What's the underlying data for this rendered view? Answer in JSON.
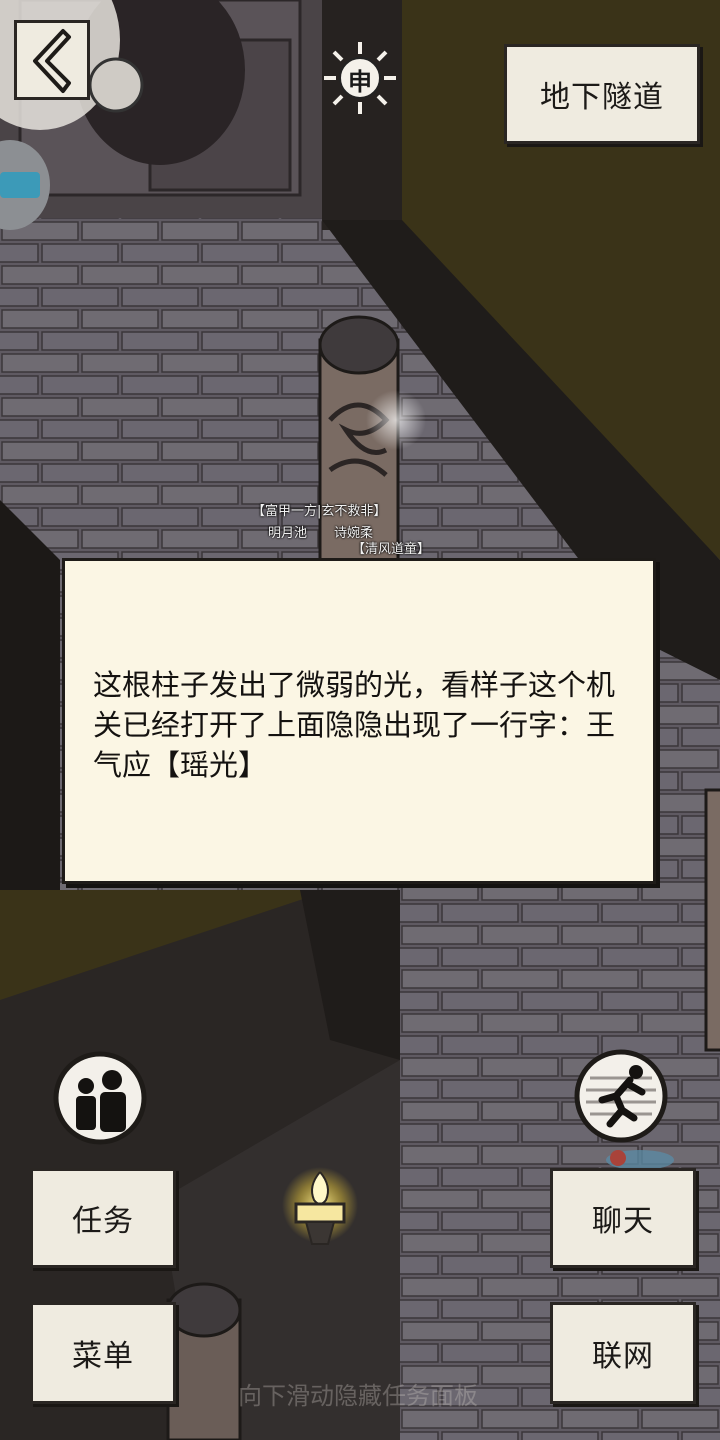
{
  "location": {
    "label": "地下隧道"
  },
  "time_badge": {
    "glyph": "申",
    "icon": "sun-icon"
  },
  "player_tags": {
    "title_top": "【富甲一方|玄不救非】",
    "name_left": "明月池",
    "name_right": "诗婉柔",
    "title_bottom": "【清风道童】"
  },
  "dialog": {
    "text": "这根柱子发出了微弱的光，看样子这个机关已经打开了上面隐隐出现了一行字：王气应【瑶光】"
  },
  "buttons": {
    "task": "任务",
    "menu": "菜单",
    "chat": "聊天",
    "online": "联网"
  },
  "icons": {
    "back": "back-arrow-icon",
    "party": "party-people-icon",
    "run": "run-icon",
    "torch": "torch-icon",
    "app_badge": "app-badge-icon"
  },
  "hint": "向下滑动隐藏任务面板",
  "colors": {
    "paper": "#efebe0",
    "dialog_bg": "#fbf6e4",
    "brick": "#6f6a71",
    "outline": "#2a2623",
    "torch_glow": "#f4d54a"
  }
}
